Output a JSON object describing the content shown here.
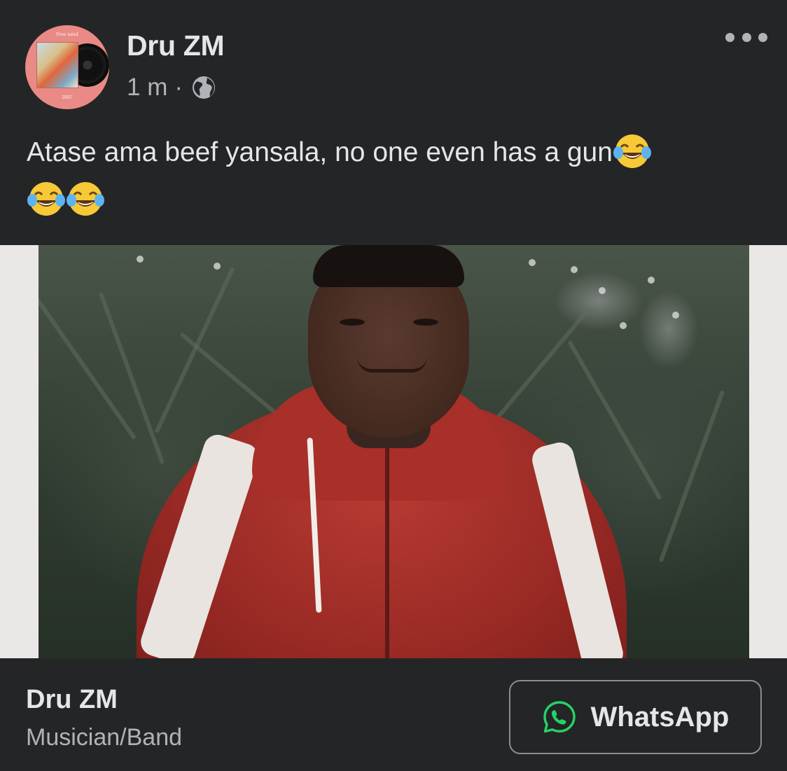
{
  "post": {
    "author": "Dru ZM",
    "time": "1 m",
    "separator": "·",
    "privacy_icon": "globe-icon",
    "menu_icon": "more-horizontal-icon",
    "text": "Atase ama beef yansala, no one even has a gun",
    "emoji": "face-with-tears-of-joy",
    "emoji_count": 3
  },
  "avatar": {
    "top_text": "Free mind",
    "bottom_text": "DRU"
  },
  "footer": {
    "page_name": "Dru ZM",
    "page_category": "Musician/Band",
    "button_label": "WhatsApp",
    "button_icon": "whatsapp-icon"
  },
  "colors": {
    "background": "#242526",
    "primary_text": "#e4e6eb",
    "secondary_text": "#b0b3b8",
    "whatsapp_green": "#25d366",
    "avatar_bg": "#e98a86"
  }
}
